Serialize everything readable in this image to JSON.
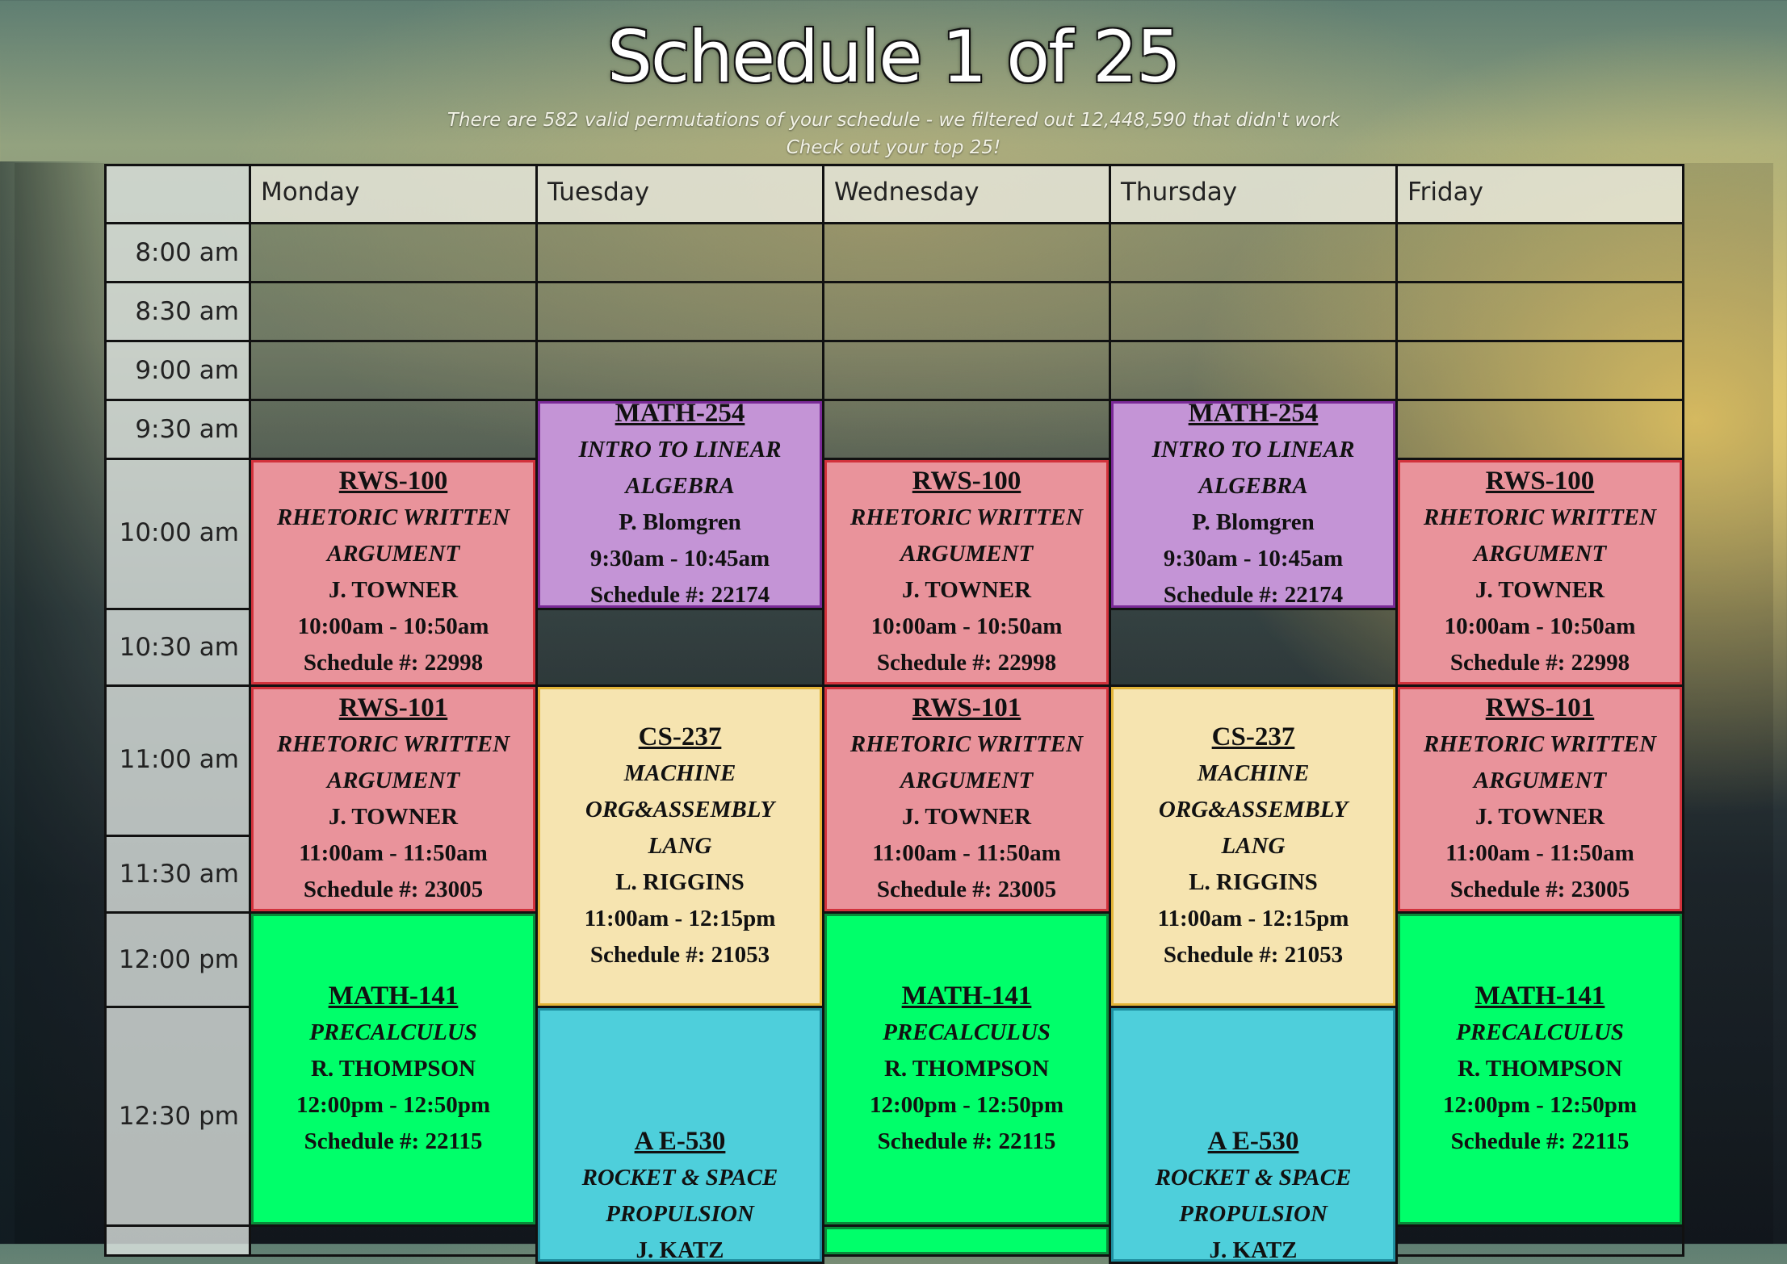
{
  "header": {
    "title": "Schedule 1 of 25",
    "subtitle1": "There are 582 valid permutations of your schedule - we filtered out 12,448,590 that didn't work",
    "subtitle2": "Check out your top 25!"
  },
  "days": [
    "Monday",
    "Tuesday",
    "Wednesday",
    "Thursday",
    "Friday"
  ],
  "times": [
    "8:00 am",
    "8:30 am",
    "9:00 am",
    "9:30 am",
    "10:00 am",
    "10:30 am",
    "11:00 am",
    "11:30 am",
    "12:00 pm",
    "12:30 pm"
  ],
  "courses": {
    "rws100": {
      "code": "RWS-100",
      "name": "RHETORIC WRITTEN ARGUMENT",
      "instructor": "J. TOWNER",
      "time": "10:00am - 10:50am",
      "schedule": "Schedule #: 22998"
    },
    "rws101": {
      "code": "RWS-101",
      "name": "RHETORIC WRITTEN ARGUMENT",
      "instructor": "J. TOWNER",
      "time": "11:00am - 11:50am",
      "schedule": "Schedule #: 23005"
    },
    "math254": {
      "code": "MATH-254",
      "name": "INTRO TO LINEAR ALGEBRA",
      "instructor": "P. Blomgren",
      "time": "9:30am - 10:45am",
      "schedule": "Schedule #: 22174"
    },
    "cs237": {
      "code": "CS-237",
      "name": "MACHINE ORG&ASSEMBLY LANG",
      "instructor": "L. RIGGINS",
      "time": "11:00am - 12:15pm",
      "schedule": "Schedule #: 21053"
    },
    "math141": {
      "code": "MATH-141",
      "name": "PRECALCULUS",
      "instructor": "R. THOMPSON",
      "time": "12:00pm - 12:50pm",
      "schedule": "Schedule #: 22115"
    },
    "ae530": {
      "code": "A E-530",
      "name": "ROCKET & SPACE PROPULSION",
      "instructor": "J. KATZ"
    }
  },
  "colors": {
    "rws": "#e9939b",
    "math254": "#c494d6",
    "cs237": "#f6e4b0",
    "ae530": "#4ecfdb",
    "math141": "#00ff6a"
  }
}
